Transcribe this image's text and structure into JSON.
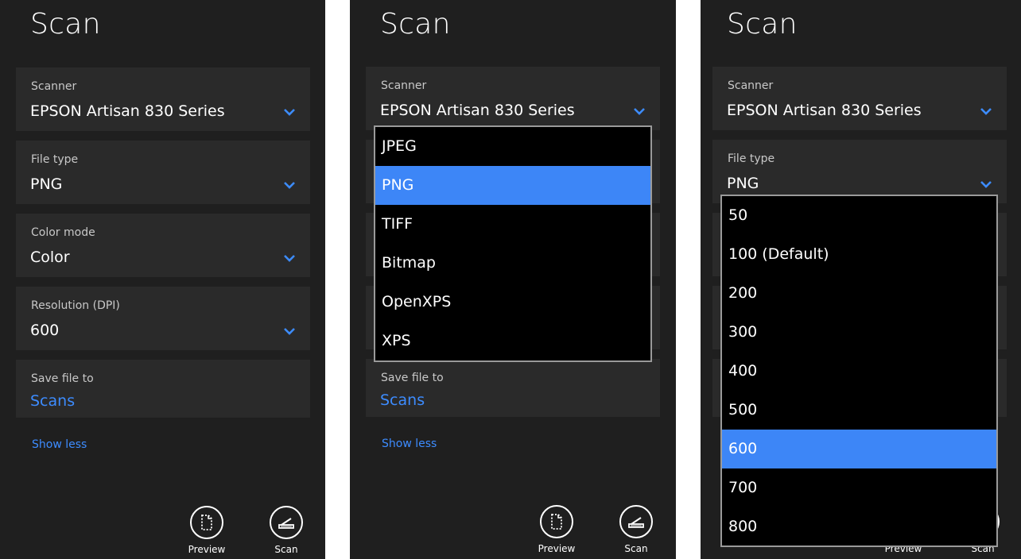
{
  "panel1": {
    "title": "Scan",
    "scanner_label": "Scanner",
    "scanner_value": "EPSON Artisan 830 Series",
    "filetype_label": "File type",
    "filetype_value": "PNG",
    "colormode_label": "Color mode",
    "colormode_value": "Color",
    "resolution_label": "Resolution (DPI)",
    "resolution_value": "600",
    "savefile_label": "Save file to",
    "savefile_value": "Scans",
    "show_less": "Show less",
    "preview_label": "Preview",
    "scan_label": "Scan"
  },
  "panel2": {
    "title": "Scan",
    "scanner_label": "Scanner",
    "scanner_value": "EPSON Artisan 830 Series",
    "filetype_options": [
      "JPEG",
      "PNG",
      "TIFF",
      "Bitmap",
      "OpenXPS",
      "XPS"
    ],
    "filetype_selected": "PNG",
    "savefile_label": "Save file to",
    "savefile_value": "Scans",
    "show_less": "Show less",
    "preview_label": "Preview",
    "scan_label": "Scan"
  },
  "panel3": {
    "title": "Scan",
    "scanner_label": "Scanner",
    "scanner_value": "EPSON Artisan 830 Series",
    "filetype_label": "File type",
    "filetype_value": "PNG",
    "resolution_options": [
      "50",
      "100 (Default)",
      "200",
      "300",
      "400",
      "500",
      "600",
      "700",
      "800"
    ],
    "resolution_selected": "600",
    "preview_label": "Preview",
    "scan_label": "Scan"
  },
  "colors": {
    "panel_bg": "#1f1f1f",
    "field_bg": "#2a2a2a",
    "accent": "#3d8cff",
    "selected_bg": "#3d86f7"
  },
  "icons": {
    "dropdown": "chevron-down-icon",
    "preview": "preview-page-icon",
    "scan": "scanner-icon"
  }
}
